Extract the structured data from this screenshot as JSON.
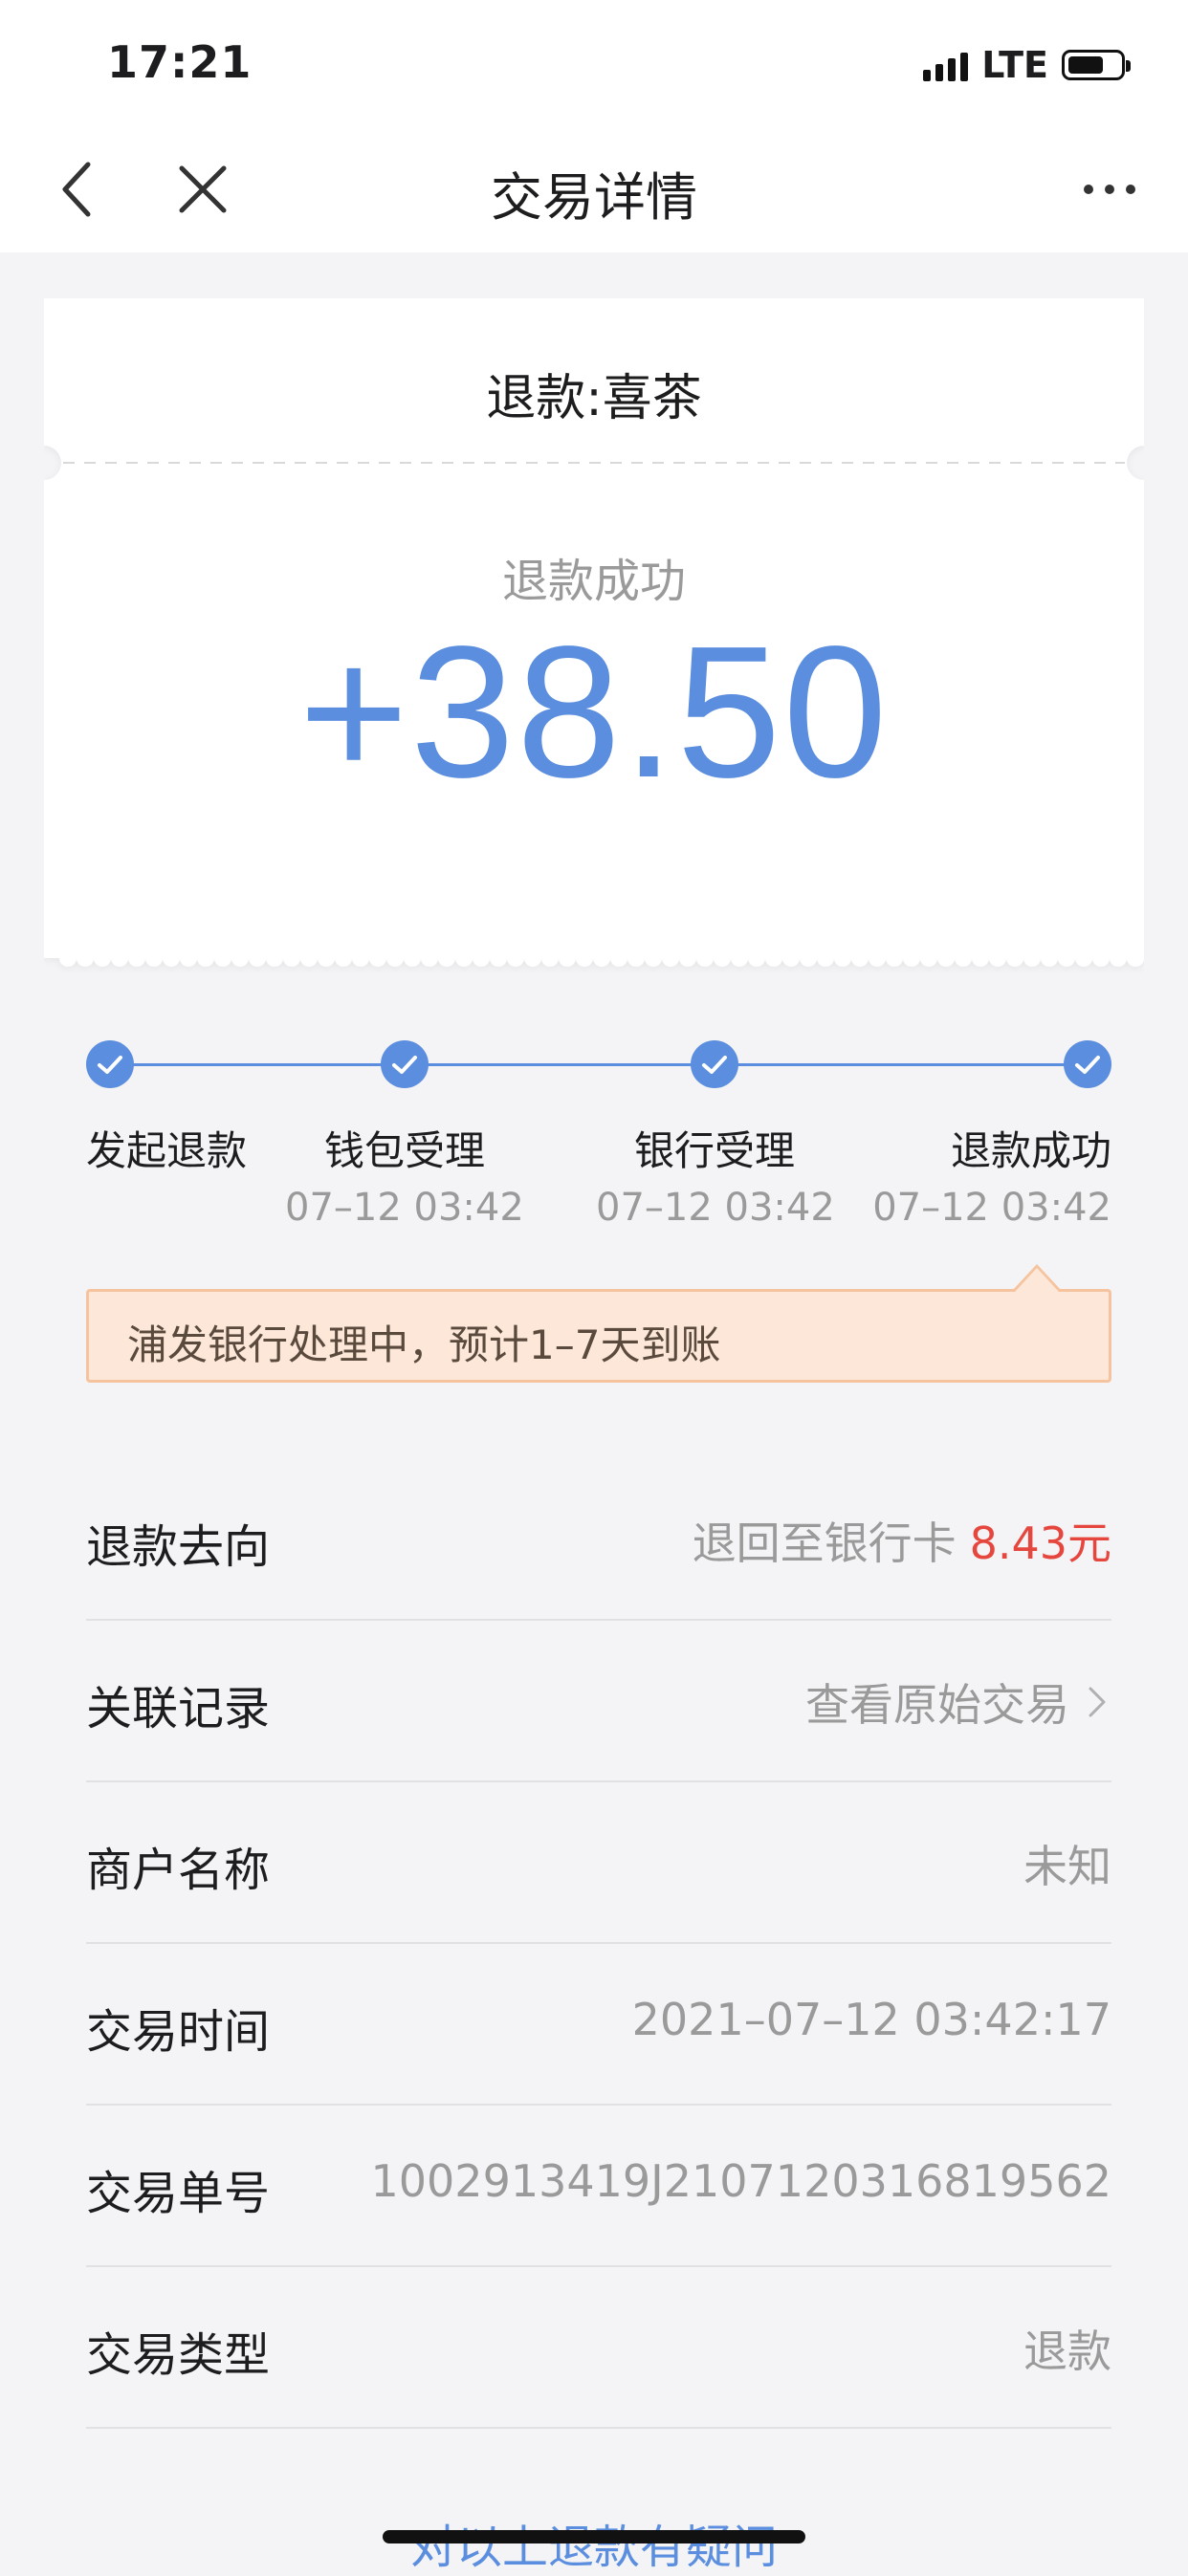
{
  "status_bar": {
    "time": "17:21",
    "network": "LTE",
    "battery_level": 0.7
  },
  "nav": {
    "title": "交易详情",
    "back_icon": "chevron-left-icon",
    "close_icon": "close-icon",
    "more_icon": "more-horizontal-icon"
  },
  "card": {
    "header": "退款:喜茶",
    "status": "退款成功",
    "amount": "+38.50",
    "amount_color": "#5b8ede"
  },
  "progress": {
    "steps": [
      {
        "label": "发起退款",
        "time": ""
      },
      {
        "label": "钱包受理",
        "time": "07–12 03:42"
      },
      {
        "label": "银行受理",
        "time": "07–12 03:42"
      },
      {
        "label": "退款成功",
        "time": "07–12 03:42"
      }
    ]
  },
  "notice": {
    "text": "浦发银行处理中，预计1–7天到账"
  },
  "details": [
    {
      "label": "退款去向",
      "value": "退回至银行卡",
      "value_accent": "8.43元"
    },
    {
      "label": "关联记录",
      "value": "查看原始交易",
      "chevron": true
    },
    {
      "label": "商户名称",
      "value": "未知"
    },
    {
      "label": "交易时间",
      "value": "2021–07–12 03:42:17"
    },
    {
      "label": "交易单号",
      "value": "1002913419J2107120316819562"
    },
    {
      "label": "交易类型",
      "value": "退款"
    }
  ],
  "bottom_link": "对以上退款有疑问",
  "colors": {
    "accent_blue": "#5b8ede",
    "accent_red": "#e5473e",
    "notice_bg": "#fde7d8",
    "notice_border": "#f5c49f"
  }
}
